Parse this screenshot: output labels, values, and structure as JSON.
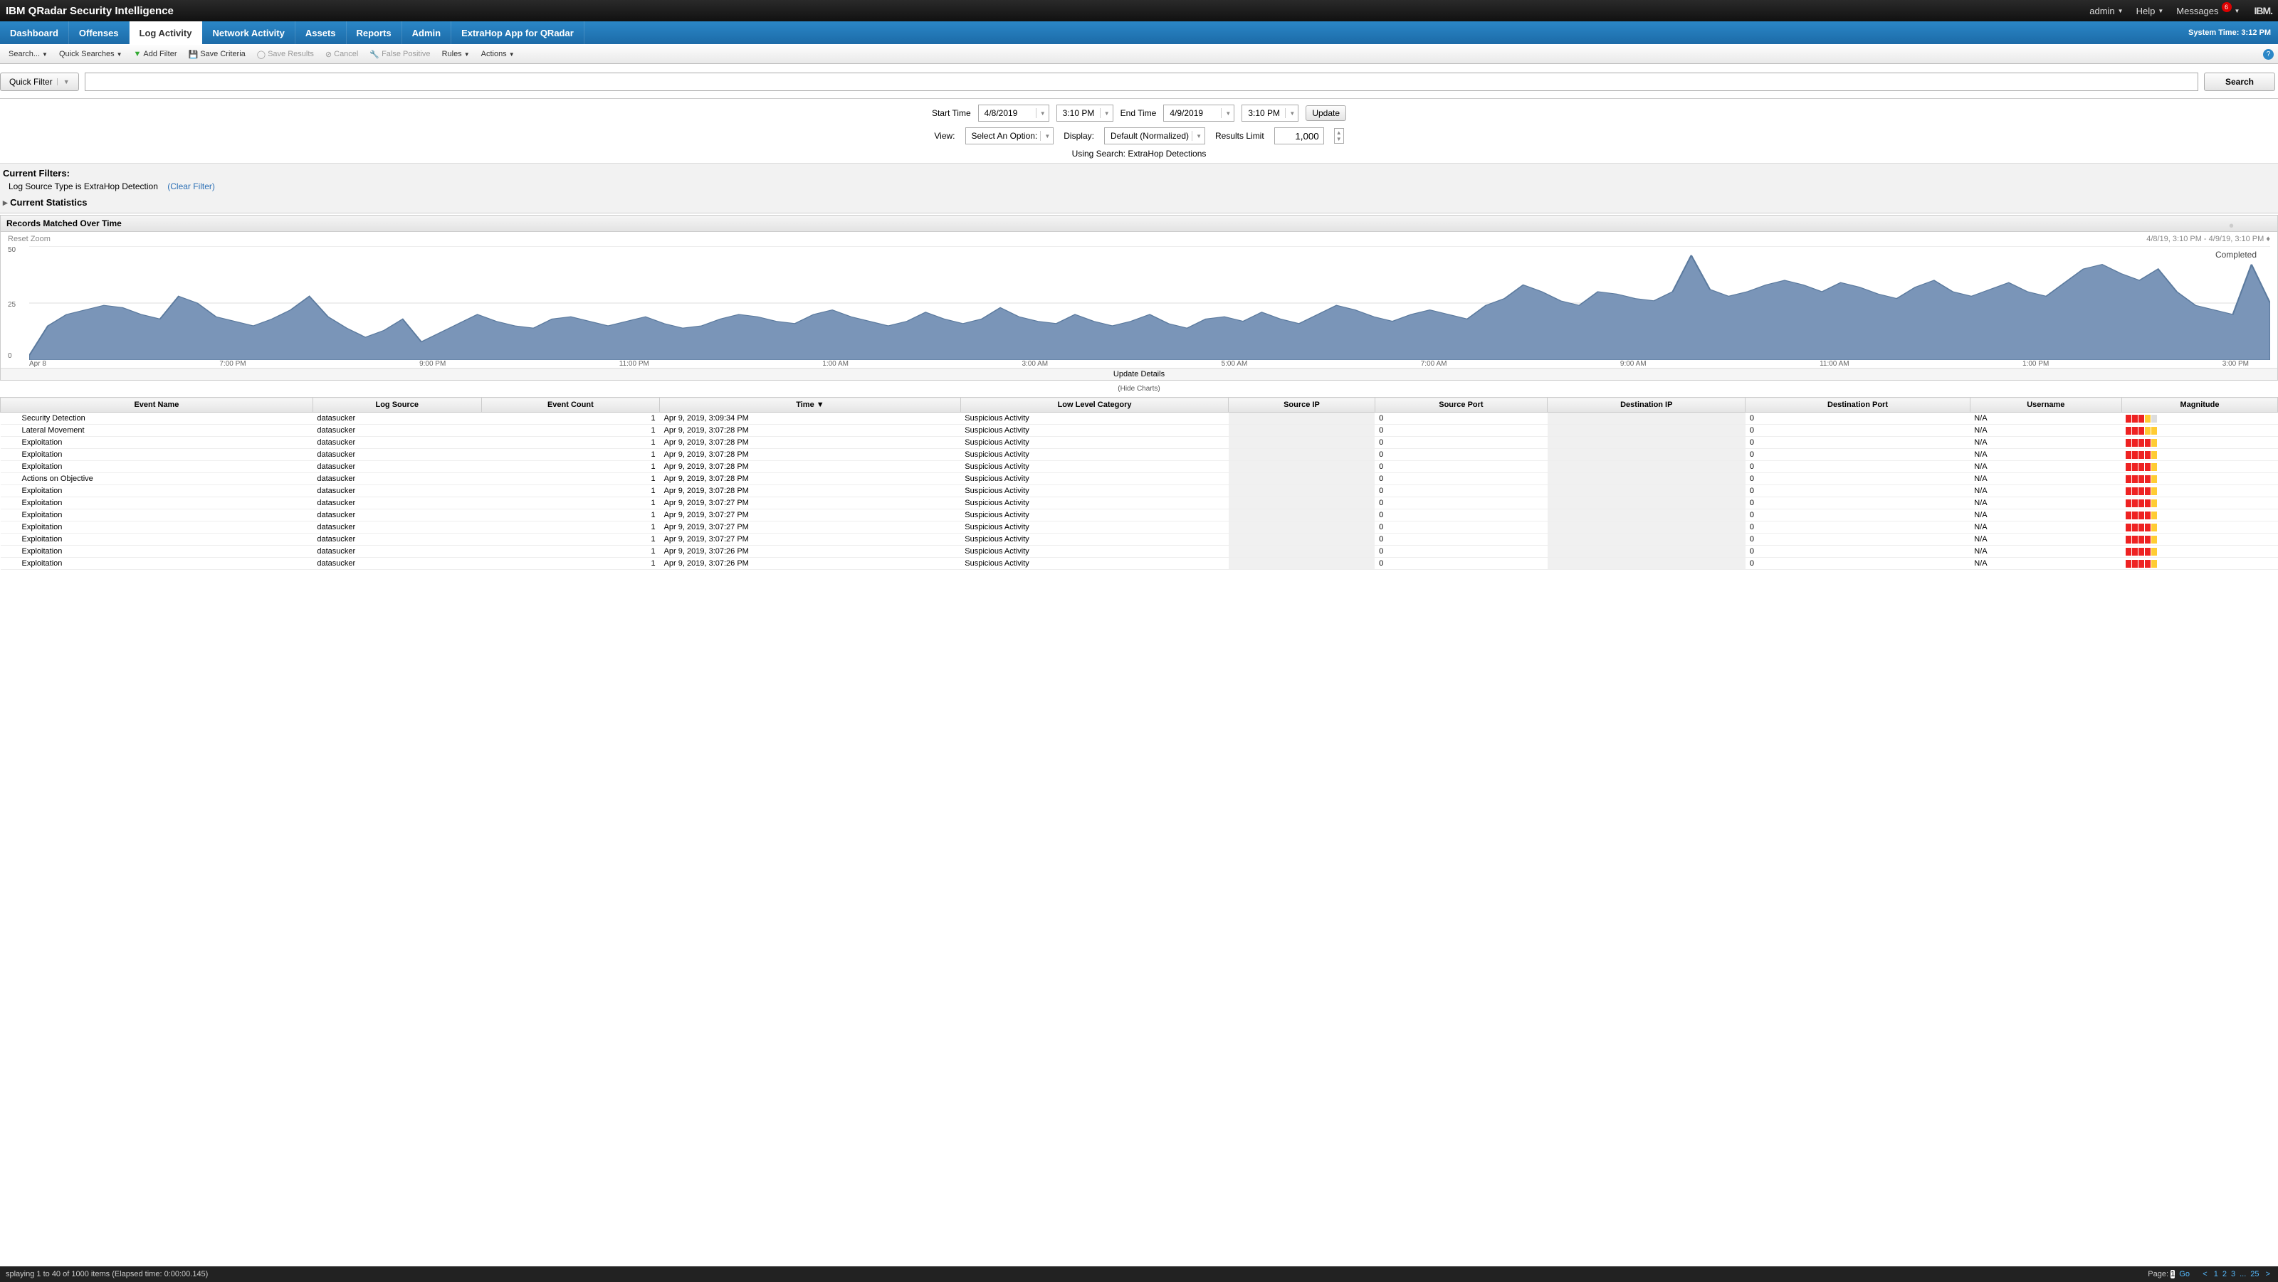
{
  "header": {
    "product": "IBM QRadar Security Intelligence",
    "user": "admin",
    "help": "Help",
    "messages": "Messages",
    "msg_count": "6",
    "brand": "IBM."
  },
  "nav": {
    "tabs": [
      "Dashboard",
      "Offenses",
      "Log Activity",
      "Network Activity",
      "Assets",
      "Reports",
      "Admin",
      "ExtraHop App for QRadar"
    ],
    "active_index": 2,
    "system_time": "System Time: 3:12 PM"
  },
  "toolbar": {
    "search": "Search...",
    "quick": "Quick Searches",
    "add_filter": "Add Filter",
    "save_criteria": "Save Criteria",
    "save_results": "Save Results",
    "cancel": "Cancel",
    "false_positive": "False Positive",
    "rules": "Rules",
    "actions": "Actions"
  },
  "quickfilter": {
    "label": "Quick Filter",
    "search_btn": "Search"
  },
  "params": {
    "start_label": "Start Time",
    "start_date": "4/8/2019",
    "start_time": "3:10 PM",
    "end_label": "End Time",
    "end_date": "4/9/2019",
    "end_time": "3:10 PM",
    "update": "Update",
    "view_label": "View:",
    "view_value": "Select An Option:",
    "display_label": "Display:",
    "display_value": "Default (Normalized)",
    "results_label": "Results Limit",
    "results_value": "1,000",
    "using_search": "Using Search: ExtraHop Detections",
    "completed": "Completed"
  },
  "filters": {
    "heading": "Current Filters:",
    "line": "Log Source Type is ExtraHop Detection",
    "clear": "(Clear Filter)",
    "stats": "Current Statistics"
  },
  "chart_section": {
    "title": "Records Matched Over Time",
    "reset": "Reset Zoom",
    "range": "4/8/19, 3:10 PM - 4/9/19, 3:10 PM",
    "update_details": "Update Details",
    "hide": "(Hide Charts)"
  },
  "chart_data": {
    "type": "area",
    "ylim": [
      0,
      50
    ],
    "yticks": [
      0,
      25,
      50
    ],
    "x_labels": [
      "Apr 8",
      "7:00 PM",
      "9:00 PM",
      "11:00 PM",
      "1:00 AM",
      "3:00 AM",
      "5:00 AM",
      "7:00 AM",
      "9:00 AM",
      "11:00 AM",
      "1:00 PM",
      "3:00 PM"
    ],
    "values": [
      2,
      15,
      20,
      22,
      24,
      23,
      20,
      18,
      28,
      25,
      19,
      17,
      15,
      18,
      22,
      28,
      19,
      14,
      10,
      13,
      18,
      8,
      12,
      16,
      20,
      17,
      15,
      14,
      18,
      19,
      17,
      15,
      17,
      19,
      16,
      14,
      15,
      18,
      20,
      19,
      17,
      16,
      20,
      22,
      19,
      17,
      15,
      17,
      21,
      18,
      16,
      18,
      23,
      19,
      17,
      16,
      20,
      17,
      15,
      17,
      20,
      16,
      14,
      18,
      19,
      17,
      21,
      18,
      16,
      20,
      24,
      22,
      19,
      17,
      20,
      22,
      20,
      18,
      24,
      27,
      33,
      30,
      26,
      24,
      30,
      29,
      27,
      26,
      30,
      46,
      31,
      28,
      30,
      33,
      35,
      33,
      30,
      34,
      32,
      29,
      27,
      32,
      35,
      30,
      28,
      31,
      34,
      30,
      28,
      34,
      40,
      42,
      38,
      35,
      40,
      30,
      24,
      22,
      20,
      42,
      25
    ]
  },
  "table": {
    "columns": [
      "Event Name",
      "Log Source",
      "Event Count",
      "Time",
      "Low Level Category",
      "Source IP",
      "Source Port",
      "Destination IP",
      "Destination Port",
      "Username",
      "Magnitude"
    ],
    "sort_col": 3,
    "rows": [
      {
        "event": "Security Detection",
        "src": "datasucker",
        "cnt": "1",
        "time": "Apr 9, 2019, 3:09:34 PM",
        "cat": "Suspicious Activity",
        "sp": "0",
        "dp": "0",
        "user": "N/A",
        "mag": [
          1,
          1,
          1,
          2,
          3
        ]
      },
      {
        "event": "Lateral Movement",
        "src": "datasucker",
        "cnt": "1",
        "time": "Apr 9, 2019, 3:07:28 PM",
        "cat": "Suspicious Activity",
        "sp": "0",
        "dp": "0",
        "user": "N/A",
        "mag": [
          1,
          1,
          1,
          2,
          2
        ]
      },
      {
        "event": "Exploitation",
        "src": "datasucker",
        "cnt": "1",
        "time": "Apr 9, 2019, 3:07:28 PM",
        "cat": "Suspicious Activity",
        "sp": "0",
        "dp": "0",
        "user": "N/A",
        "mag": [
          1,
          1,
          1,
          1,
          2
        ]
      },
      {
        "event": "Exploitation",
        "src": "datasucker",
        "cnt": "1",
        "time": "Apr 9, 2019, 3:07:28 PM",
        "cat": "Suspicious Activity",
        "sp": "0",
        "dp": "0",
        "user": "N/A",
        "mag": [
          1,
          1,
          1,
          1,
          2
        ]
      },
      {
        "event": "Exploitation",
        "src": "datasucker",
        "cnt": "1",
        "time": "Apr 9, 2019, 3:07:28 PM",
        "cat": "Suspicious Activity",
        "sp": "0",
        "dp": "0",
        "user": "N/A",
        "mag": [
          1,
          1,
          1,
          1,
          2
        ]
      },
      {
        "event": "Actions on Objective",
        "src": "datasucker",
        "cnt": "1",
        "time": "Apr 9, 2019, 3:07:28 PM",
        "cat": "Suspicious Activity",
        "sp": "0",
        "dp": "0",
        "user": "N/A",
        "mag": [
          1,
          1,
          1,
          1,
          2
        ]
      },
      {
        "event": "Exploitation",
        "src": "datasucker",
        "cnt": "1",
        "time": "Apr 9, 2019, 3:07:28 PM",
        "cat": "Suspicious Activity",
        "sp": "0",
        "dp": "0",
        "user": "N/A",
        "mag": [
          1,
          1,
          1,
          1,
          2
        ]
      },
      {
        "event": "Exploitation",
        "src": "datasucker",
        "cnt": "1",
        "time": "Apr 9, 2019, 3:07:27 PM",
        "cat": "Suspicious Activity",
        "sp": "0",
        "dp": "0",
        "user": "N/A",
        "mag": [
          1,
          1,
          1,
          1,
          2
        ]
      },
      {
        "event": "Exploitation",
        "src": "datasucker",
        "cnt": "1",
        "time": "Apr 9, 2019, 3:07:27 PM",
        "cat": "Suspicious Activity",
        "sp": "0",
        "dp": "0",
        "user": "N/A",
        "mag": [
          1,
          1,
          1,
          1,
          2
        ]
      },
      {
        "event": "Exploitation",
        "src": "datasucker",
        "cnt": "1",
        "time": "Apr 9, 2019, 3:07:27 PM",
        "cat": "Suspicious Activity",
        "sp": "0",
        "dp": "0",
        "user": "N/A",
        "mag": [
          1,
          1,
          1,
          1,
          2
        ]
      },
      {
        "event": "Exploitation",
        "src": "datasucker",
        "cnt": "1",
        "time": "Apr 9, 2019, 3:07:27 PM",
        "cat": "Suspicious Activity",
        "sp": "0",
        "dp": "0",
        "user": "N/A",
        "mag": [
          1,
          1,
          1,
          1,
          2
        ]
      },
      {
        "event": "Exploitation",
        "src": "datasucker",
        "cnt": "1",
        "time": "Apr 9, 2019, 3:07:26 PM",
        "cat": "Suspicious Activity",
        "sp": "0",
        "dp": "0",
        "user": "N/A",
        "mag": [
          1,
          1,
          1,
          1,
          2
        ]
      },
      {
        "event": "Exploitation",
        "src": "datasucker",
        "cnt": "1",
        "time": "Apr 9, 2019, 3:07:26 PM",
        "cat": "Suspicious Activity",
        "sp": "0",
        "dp": "0",
        "user": "N/A",
        "mag": [
          1,
          1,
          1,
          1,
          2
        ]
      }
    ]
  },
  "status": {
    "left": "splaying 1 to 40 of 1000 items (Elapsed time: 0:00:00.145)",
    "page_label": "Page:",
    "page_num": "1",
    "go": "Go",
    "pages": [
      "1",
      "2",
      "3",
      "...",
      "25"
    ]
  }
}
